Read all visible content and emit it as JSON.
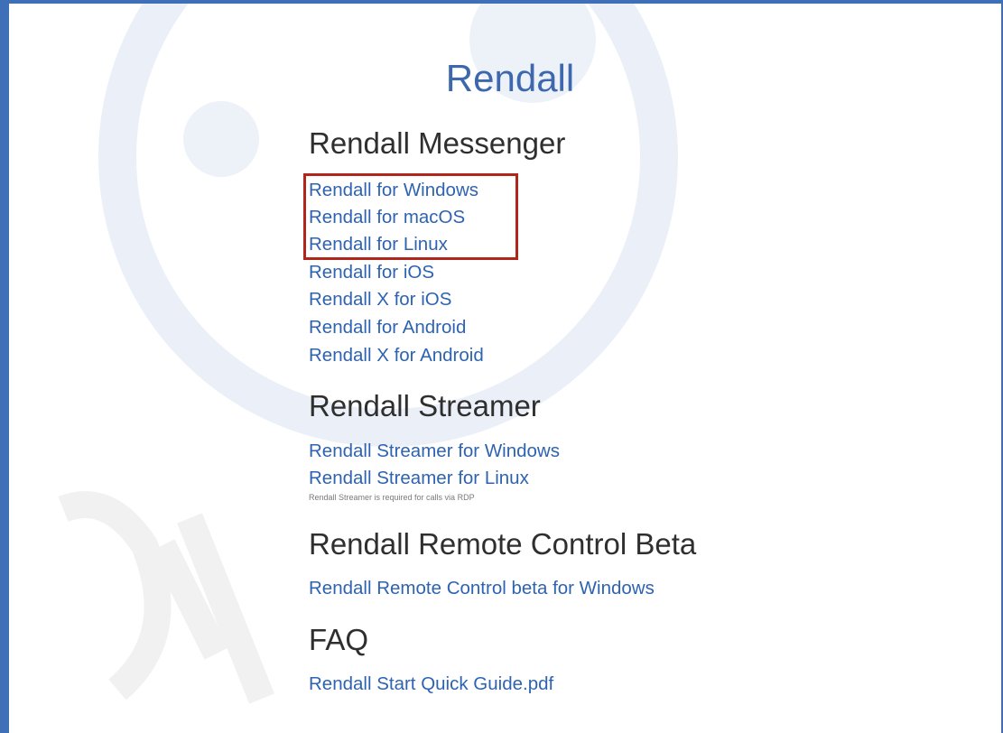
{
  "site_title": "Rendall",
  "sections": {
    "messenger": {
      "title": "Rendall Messenger",
      "links": [
        "Rendall for Windows",
        "Rendall for macOS",
        "Rendall for Linux",
        "Rendall for iOS",
        "Rendall X for iOS",
        "Rendall for Android",
        "Rendall X for Android"
      ]
    },
    "streamer": {
      "title": "Rendall Streamer",
      "links": [
        "Rendall Streamer for Windows",
        "Rendall Streamer for Linux"
      ],
      "note": "Rendall Streamer is required for calls via RDP"
    },
    "remote_control": {
      "title": "Rendall Remote Control Beta",
      "links": [
        "Rendall Remote Control beta for Windows"
      ]
    },
    "faq": {
      "title": "FAQ",
      "links": [
        "Rendall Start Quick Guide.pdf"
      ]
    }
  },
  "colors": {
    "frame": "#3f6fb6",
    "title": "#3d68ad",
    "link": "#2e63b1",
    "heading": "#2f2f2f",
    "highlight": "#b0261b"
  }
}
